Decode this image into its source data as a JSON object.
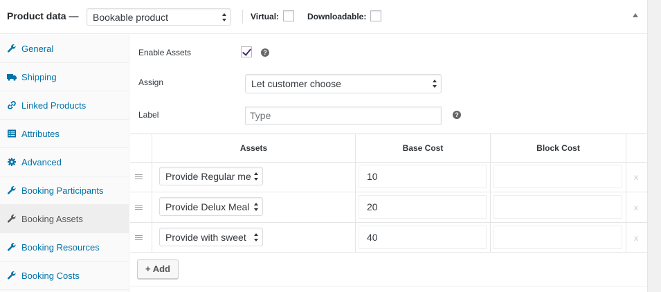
{
  "header": {
    "title": "Product data —",
    "product_type": "Bookable product",
    "virtual_label": "Virtual:",
    "downloadable_label": "Downloadable:"
  },
  "sidebar": {
    "items": [
      {
        "label": "General",
        "icon": "wrench-icon"
      },
      {
        "label": "Shipping",
        "icon": "truck-icon"
      },
      {
        "label": "Linked Products",
        "icon": "link-icon"
      },
      {
        "label": "Attributes",
        "icon": "list-icon"
      },
      {
        "label": "Advanced",
        "icon": "gear-icon"
      },
      {
        "label": "Booking Participants",
        "icon": "wrench-icon"
      },
      {
        "label": "Booking Assets",
        "icon": "wrench-icon",
        "active": true
      },
      {
        "label": "Booking Resources",
        "icon": "wrench-icon"
      },
      {
        "label": "Booking Costs",
        "icon": "wrench-icon"
      }
    ]
  },
  "form": {
    "enable_assets_label": "Enable Assets",
    "enable_assets_checked": true,
    "assign_label": "Assign",
    "assign_value": "Let customer choose",
    "label_label": "Label",
    "label_placeholder": "Type",
    "help_glyph": "?"
  },
  "table": {
    "headers": [
      "Assets",
      "Base Cost",
      "Block Cost"
    ],
    "rows": [
      {
        "asset": "Provide Regular me",
        "base_cost": "10",
        "block_cost": ""
      },
      {
        "asset": "Provide Delux Meal",
        "base_cost": "20",
        "block_cost": ""
      },
      {
        "asset": "Provide with sweet",
        "base_cost": "40",
        "block_cost": ""
      }
    ],
    "remove_glyph": "x",
    "add_label": "+ Add"
  },
  "colors": {
    "link": "#0073aa",
    "active_tab_bg": "#eeeeee",
    "check": "#4a2e6b"
  }
}
